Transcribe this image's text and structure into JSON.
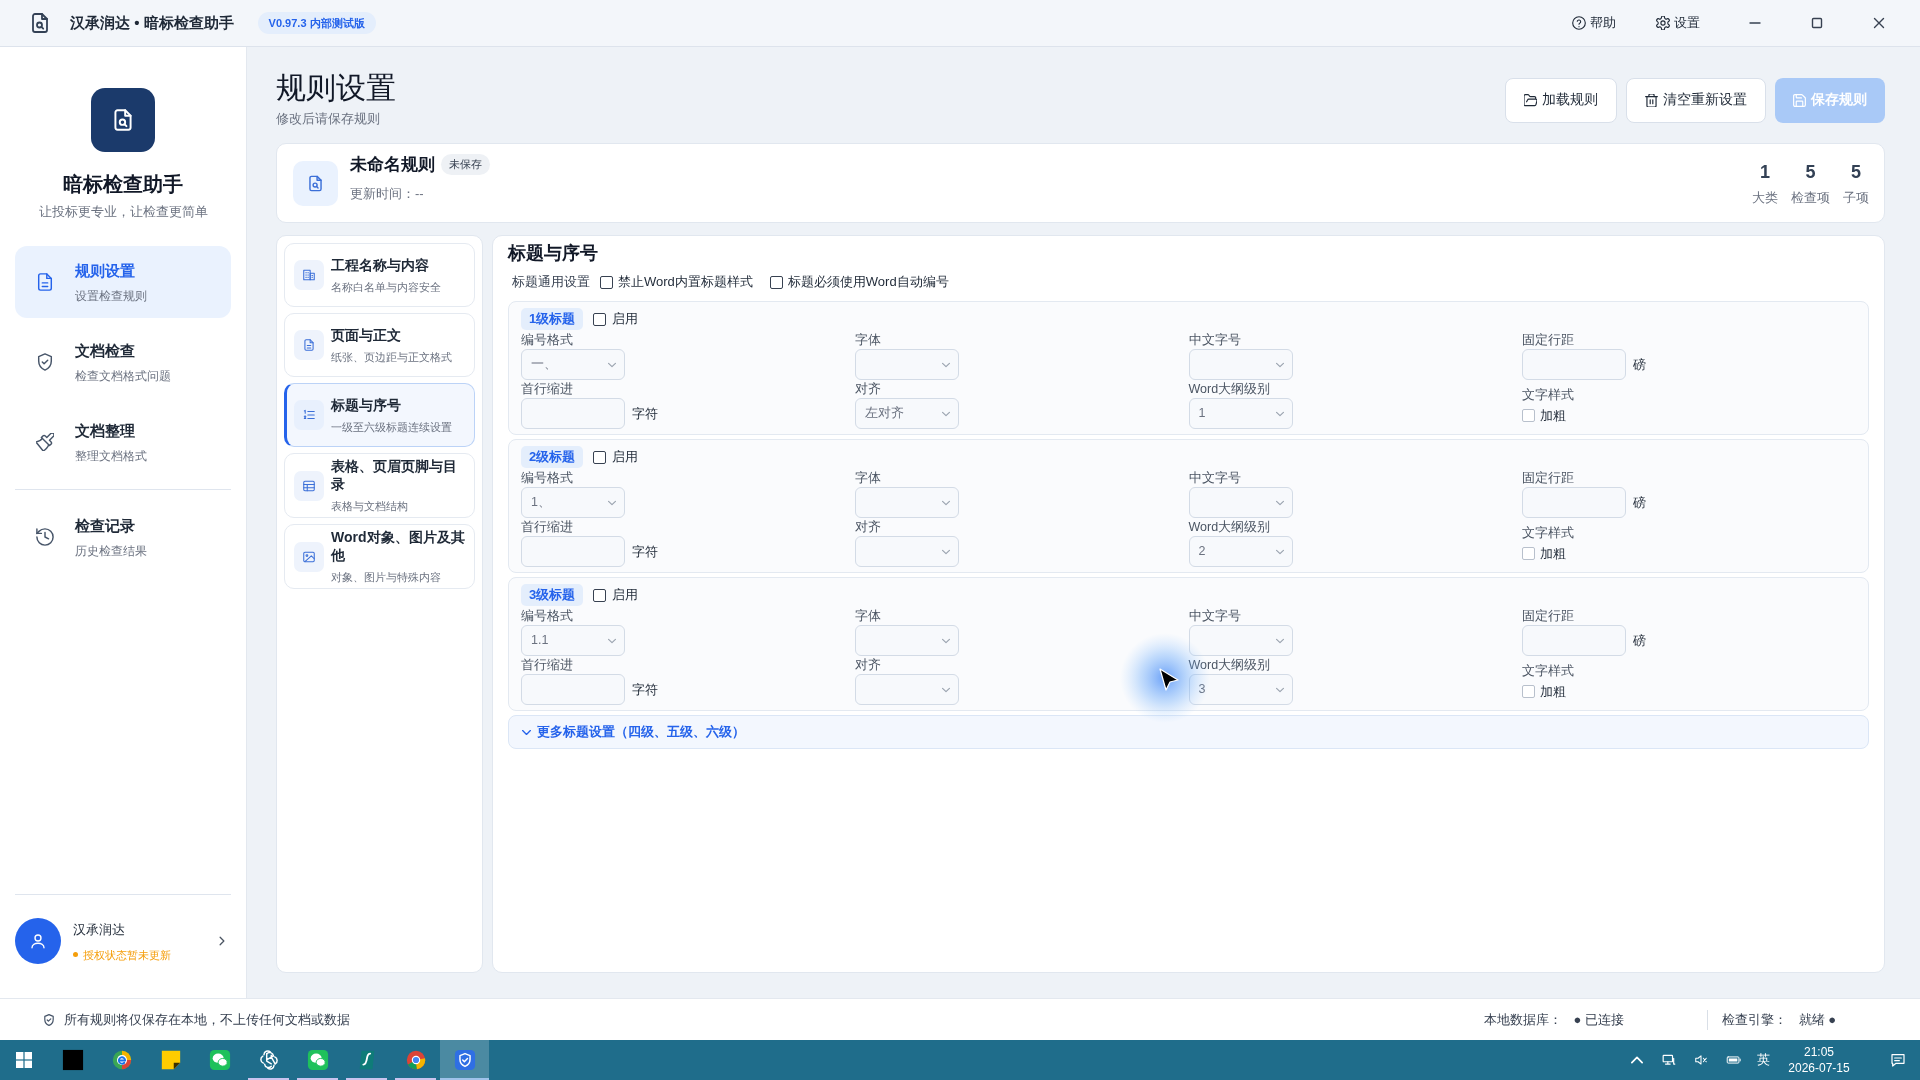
{
  "window": {
    "title": "汉承润达 • 暗标检查助手",
    "version": "V0.97.3 内部测试版",
    "actions": [
      {
        "kind": "help",
        "label": "帮助"
      },
      {
        "kind": "settings",
        "label": "设置"
      }
    ]
  },
  "sidebar": {
    "app_name": "暗标检查助手",
    "tagline": "让投标更专业，让检查更简单",
    "groups": [
      {
        "items": [
          {
            "kind": "rules",
            "label": "规则设置",
            "description": "设置检查规则",
            "selected": true
          },
          {
            "kind": "check",
            "label": "文档检查",
            "description": "检查文档格式问题",
            "selected": false
          },
          {
            "kind": "organize",
            "label": "文档整理",
            "description": "整理文档格式",
            "selected": false
          }
        ]
      },
      {
        "items": [
          {
            "kind": "history",
            "label": "检查记录",
            "description": "历史检查结果",
            "selected": false
          }
        ]
      }
    ],
    "user": {
      "name": "汉承润达",
      "status": "授权状态暂未更新"
    }
  },
  "page": {
    "title": "规则设置",
    "subtitle": "修改后请保存规则",
    "buttons": [
      {
        "kind": "load",
        "label": "加载规则",
        "disabled": false
      },
      {
        "kind": "reset",
        "label": "清空重新设置",
        "disabled": false
      },
      {
        "kind": "save",
        "label": "保存规则",
        "disabled": true
      }
    ]
  },
  "rule": {
    "name": "未命名规则",
    "badge": "未保存",
    "updated": "更新时间：--",
    "stats": [
      {
        "value": "1",
        "label": "大类"
      },
      {
        "value": "5",
        "label": "检查项"
      },
      {
        "value": "5",
        "label": "子项"
      }
    ]
  },
  "categories": [
    {
      "kind": "project",
      "title": "工程名称与内容",
      "description": "名称白名单与内容安全",
      "selected": false
    },
    {
      "kind": "page",
      "title": "页面与正文",
      "description": "纸张、页边距与正文格式",
      "selected": false
    },
    {
      "kind": "headings",
      "title": "标题与序号",
      "description": "一级至六级标题连续设置",
      "selected": true
    },
    {
      "kind": "table",
      "title": "表格、页眉页脚与目录",
      "description": "表格与文档结构",
      "selected": false
    },
    {
      "kind": "objects",
      "title": "Word对象、图片及其他",
      "description": "对象、图片与特殊内容",
      "selected": false
    }
  ],
  "section": {
    "title": "标题与序号",
    "general": {
      "label": "标题通用设置",
      "options": [
        {
          "label": "禁止Word内置标题样式",
          "checked": false
        },
        {
          "label": "标题必须使用Word自动编号",
          "checked": false
        }
      ]
    },
    "levels": [
      {
        "tag": "1级标题",
        "enabled_label": "启用",
        "enabled": false,
        "fields": [
          {
            "kind": "select",
            "label": "编号格式",
            "value": "一、"
          },
          {
            "kind": "select",
            "label": "字体"
          },
          {
            "kind": "select",
            "label": "中文字号"
          },
          {
            "kind": "input",
            "label": "固定行距",
            "unit": "磅"
          },
          {
            "kind": "input",
            "label": "首行缩进",
            "unit": "字符"
          },
          {
            "kind": "select",
            "label": "对齐",
            "value": "左对齐"
          },
          {
            "kind": "select",
            "label": "Word大纲级别",
            "value": "1"
          },
          {
            "kind": "checkbox",
            "label": "文字样式",
            "option": "加粗",
            "checked": false
          }
        ]
      },
      {
        "tag": "2级标题",
        "enabled_label": "启用",
        "enabled": false,
        "fields": [
          {
            "kind": "select",
            "label": "编号格式",
            "value": "1、"
          },
          {
            "kind": "select",
            "label": "字体"
          },
          {
            "kind": "select",
            "label": "中文字号"
          },
          {
            "kind": "input",
            "label": "固定行距",
            "unit": "磅"
          },
          {
            "kind": "input",
            "label": "首行缩进",
            "unit": "字符"
          },
          {
            "kind": "select",
            "label": "对齐"
          },
          {
            "kind": "select",
            "label": "Word大纲级别",
            "value": "2"
          },
          {
            "kind": "checkbox",
            "label": "文字样式",
            "option": "加粗",
            "checked": false
          }
        ]
      },
      {
        "tag": "3级标题",
        "enabled_label": "启用",
        "enabled": false,
        "fields": [
          {
            "kind": "select",
            "label": "编号格式",
            "value": "1.1"
          },
          {
            "kind": "select",
            "label": "字体"
          },
          {
            "kind": "select",
            "label": "中文字号"
          },
          {
            "kind": "input",
            "label": "固定行距",
            "unit": "磅"
          },
          {
            "kind": "input",
            "label": "首行缩进",
            "unit": "字符"
          },
          {
            "kind": "select",
            "label": "对齐"
          },
          {
            "kind": "select",
            "label": "Word大纲级别",
            "value": "3"
          },
          {
            "kind": "checkbox",
            "label": "文字样式",
            "option": "加粗",
            "checked": false
          }
        ]
      }
    ],
    "more": {
      "label": "更多标题设置（四级、五级、六级）",
      "expanded": false
    }
  },
  "status_bar": {
    "notice": "所有规则将仅保存在本地，不上传任何文档或数据",
    "items": [
      {
        "label": "本地数据库：",
        "value": "● 已连接"
      },
      {
        "label": "检查引擎：",
        "value": "就绪 ●"
      }
    ]
  },
  "taskbar": {
    "apps": [
      {
        "kind": "terminal",
        "running": false,
        "selected": false
      },
      {
        "kind": "ring",
        "running": false,
        "selected": false
      },
      {
        "kind": "notes",
        "running": false,
        "selected": false
      },
      {
        "kind": "chat",
        "running": false,
        "selected": false
      },
      {
        "kind": "knot",
        "running": true,
        "selected": false
      },
      {
        "kind": "chat",
        "running": true,
        "selected": false
      },
      {
        "kind": "script",
        "running": true,
        "selected": false
      },
      {
        "kind": "tricolor",
        "running": true,
        "selected": false
      },
      {
        "kind": "shield",
        "running": true,
        "selected": true
      }
    ],
    "tray": {
      "volume_muted": true,
      "ime": "英",
      "time": "21:05",
      "date": "2026-07-15"
    }
  }
}
